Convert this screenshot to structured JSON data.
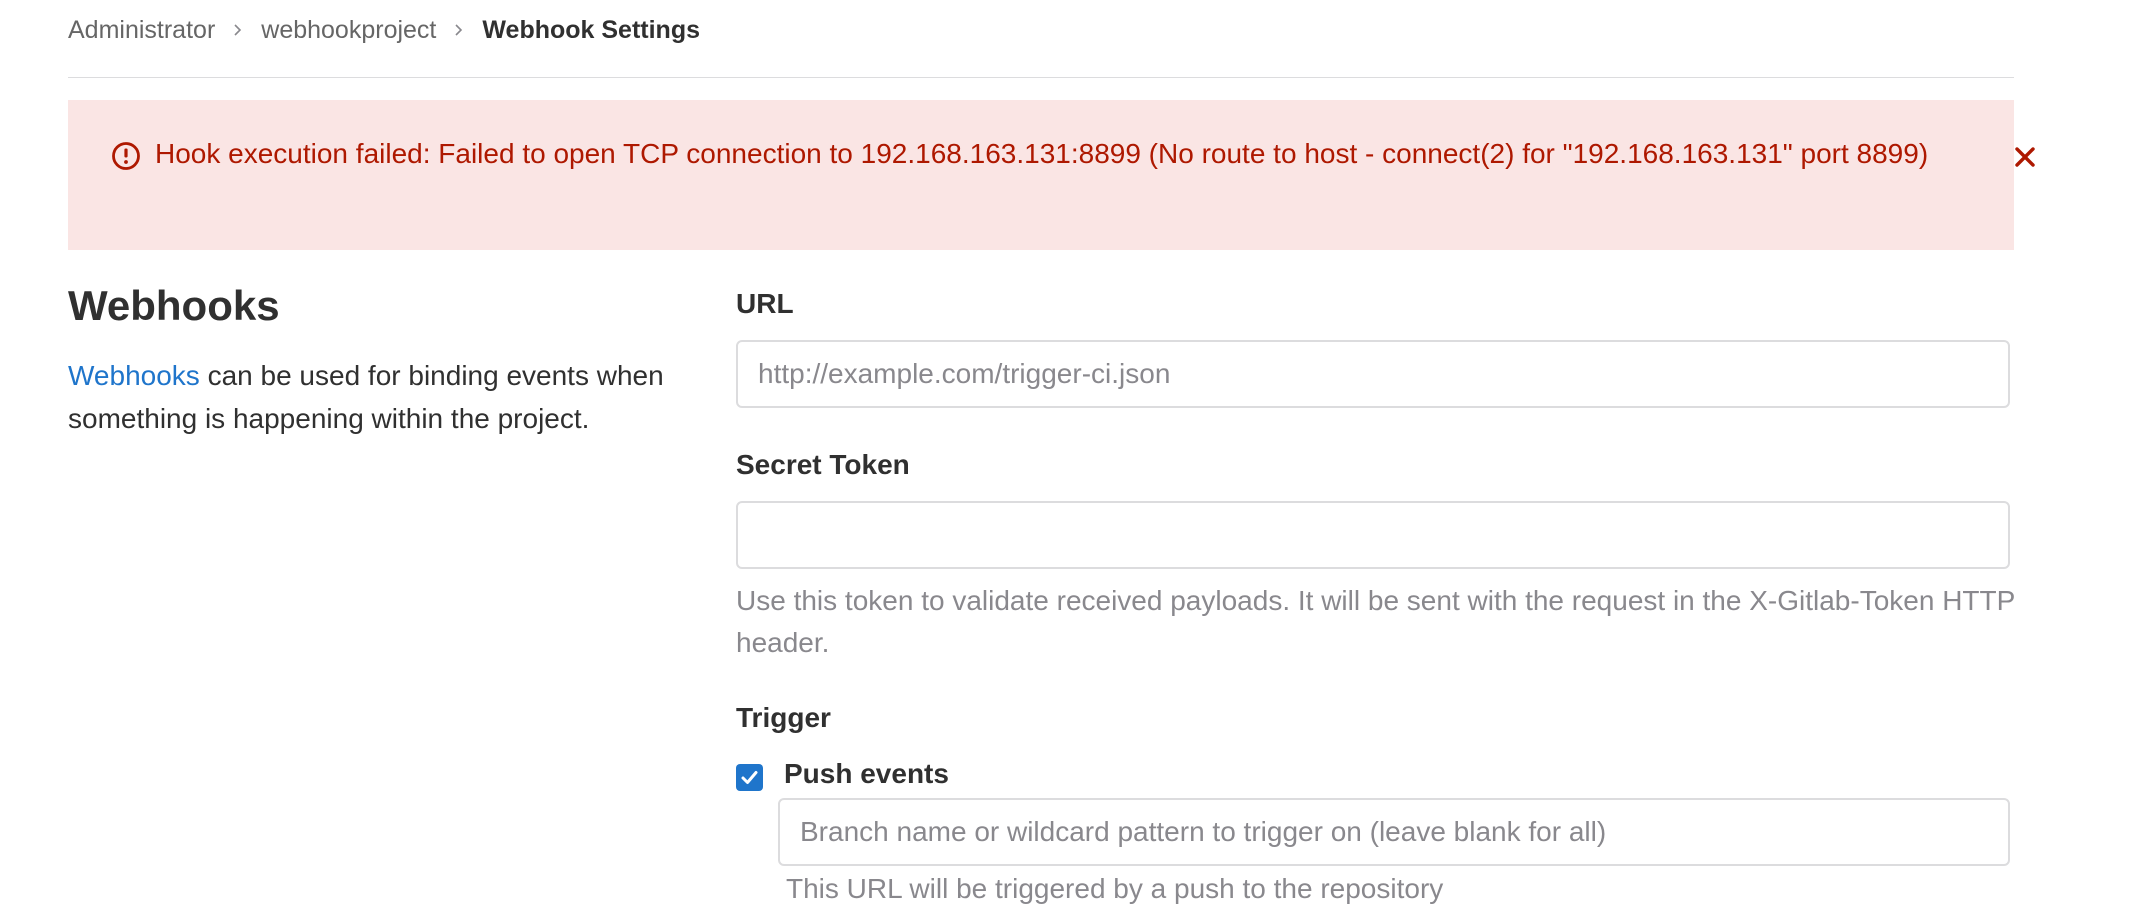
{
  "breadcrumb": {
    "items": [
      "Administrator",
      "webhookproject"
    ],
    "current": "Webhook Settings"
  },
  "alert": {
    "message": "Hook execution failed: Failed to open TCP connection to 192.168.163.131:8899 (No route to host - connect(2) for \"192.168.163.131\" port 8899)",
    "icon": "error-circle-icon",
    "close_icon": "close-icon",
    "color": "#ae1800",
    "background": "#fae5e4"
  },
  "section": {
    "title": "Webhooks",
    "desc_link": "Webhooks",
    "desc_text": " can be used for binding events when something is happening within the project."
  },
  "form": {
    "url_label": "URL",
    "url_placeholder": "http://example.com/trigger-ci.json",
    "url_value": "",
    "token_label": "Secret Token",
    "token_value": "",
    "token_help": "Use this token to validate received payloads. It will be sent with the request in the X-Gitlab-Token HTTP header.",
    "trigger_label": "Trigger",
    "push_events_label": "Push events",
    "push_events_checked": true,
    "branch_placeholder": "Branch name or wildcard pattern to trigger on (leave blank for all)",
    "push_help": "This URL will be triggered by a push to the repository"
  },
  "colors": {
    "accent": "#1f75cb",
    "text": "#303030",
    "muted": "#89888d"
  }
}
